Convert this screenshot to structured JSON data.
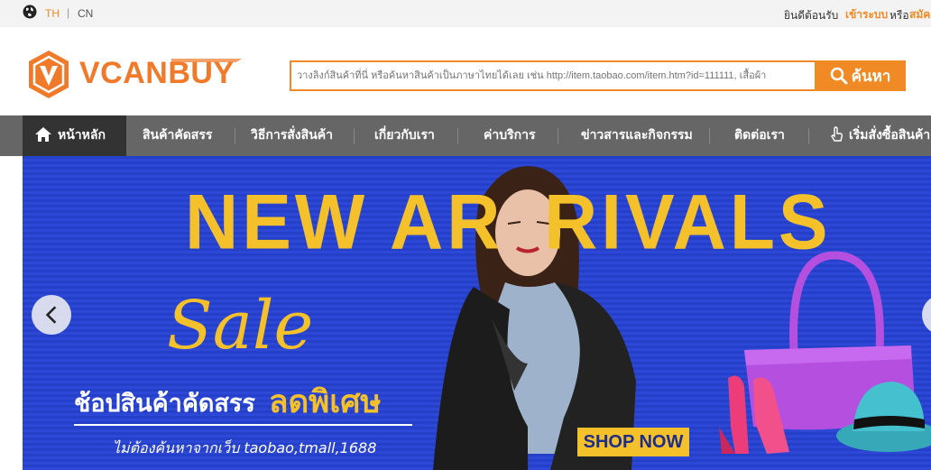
{
  "topbar": {
    "languages": [
      "TH",
      "CN"
    ],
    "separator": "|",
    "welcome": "ยินดีต้อนรับ",
    "login": "เข้าระบบ",
    "or": "หรือ",
    "register": "สมัคร"
  },
  "header": {
    "logo_text": "VCANBUY",
    "search_placeholder": "วางลิงก์สินค้าที่นี่ หรือค้นหาสินค้าเป็นภาษาไทยได้เลย เช่น http://item.taobao.com/item.htm?id=111111, เสื้อผ้า",
    "search_button": "ค้นหา"
  },
  "nav": {
    "items": [
      {
        "label": "หน้าหลัก",
        "icon": "home-icon",
        "active": true
      },
      {
        "label": "สินค้าคัดสรร"
      },
      {
        "label": "วิธีการสั่งสินค้า"
      },
      {
        "label": "เกี่ยวกับเรา"
      },
      {
        "label": "ค่าบริการ"
      },
      {
        "label": "ข่าวสารและกิจกรรม"
      },
      {
        "label": "ติดต่อเรา"
      },
      {
        "label": "เริ่มสั่งซื้อสินค้า",
        "icon": "pointer-hand-icon"
      }
    ]
  },
  "banner": {
    "headline_left": "NEW AR",
    "headline_right": "RIVALS",
    "sale": "Sale",
    "sale_sub": "ช้อปสินค้าคัดสรร",
    "sale_special": "ลดพิเศษ",
    "sale_note": "ไม่ต้องค้นหาจากเว็บ taobao,tmall,1688",
    "cta": "SHOP NOW"
  },
  "colors": {
    "accent": "#f08a24",
    "nav_bg": "#666666",
    "nav_active": "#333333",
    "banner_blue": "#2d48d6",
    "banner_yellow": "#f5c12a"
  }
}
